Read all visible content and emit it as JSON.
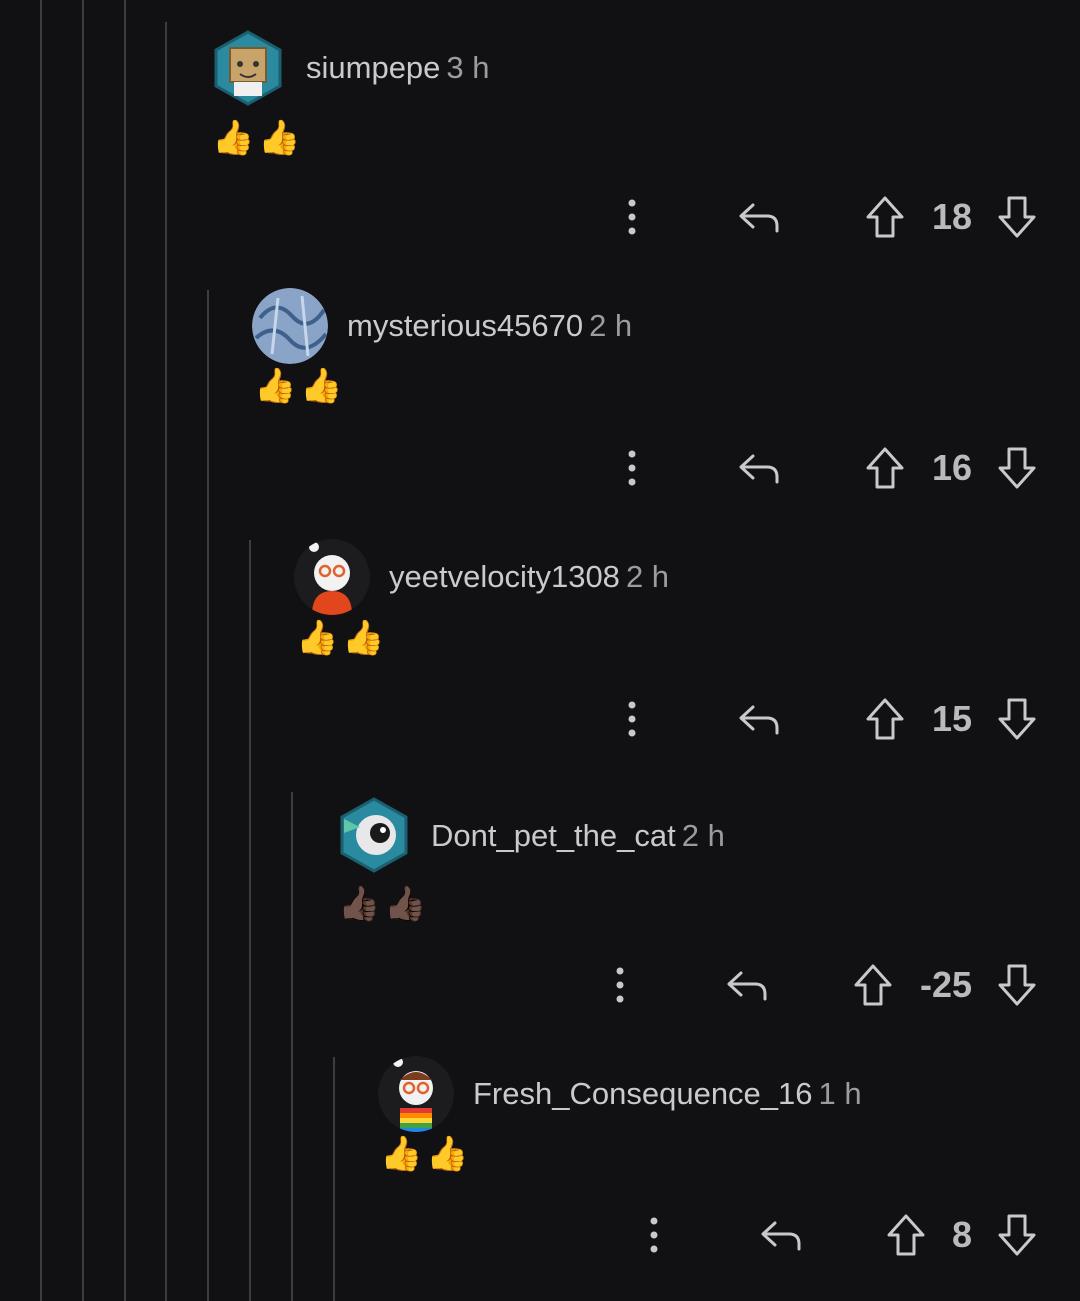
{
  "colors": {
    "background": "#111113",
    "thread_line": "#3c3d40",
    "text": "#c9cacd",
    "muted": "#9a9ca0"
  },
  "comments": [
    {
      "username": "siumpepe",
      "time": "3 h",
      "body": "👍👍",
      "score": "18",
      "avatar": "cardboard-box-snoo-avatar"
    },
    {
      "username": "mysterious45670",
      "time": "2 h",
      "body": "👍👍",
      "score": "16",
      "avatar": "blue-texture-avatar"
    },
    {
      "username": "yeetvelocity1308",
      "time": "2 h",
      "body": "👍👍",
      "score": "15",
      "avatar": "snoo-glasses-avatar"
    },
    {
      "username": "Dont_pet_the_cat",
      "time": "2 h",
      "body": "👍🏿👍🏿",
      "score": "-25",
      "avatar": "astronaut-helmet-avatar"
    },
    {
      "username": "Fresh_Consequence_16",
      "time": "1 h",
      "body": "👍👍",
      "score": "8",
      "avatar": "snoo-rainbow-avatar"
    }
  ],
  "icons": [
    "more-icon",
    "reply-icon",
    "upvote-icon",
    "downvote-icon"
  ]
}
